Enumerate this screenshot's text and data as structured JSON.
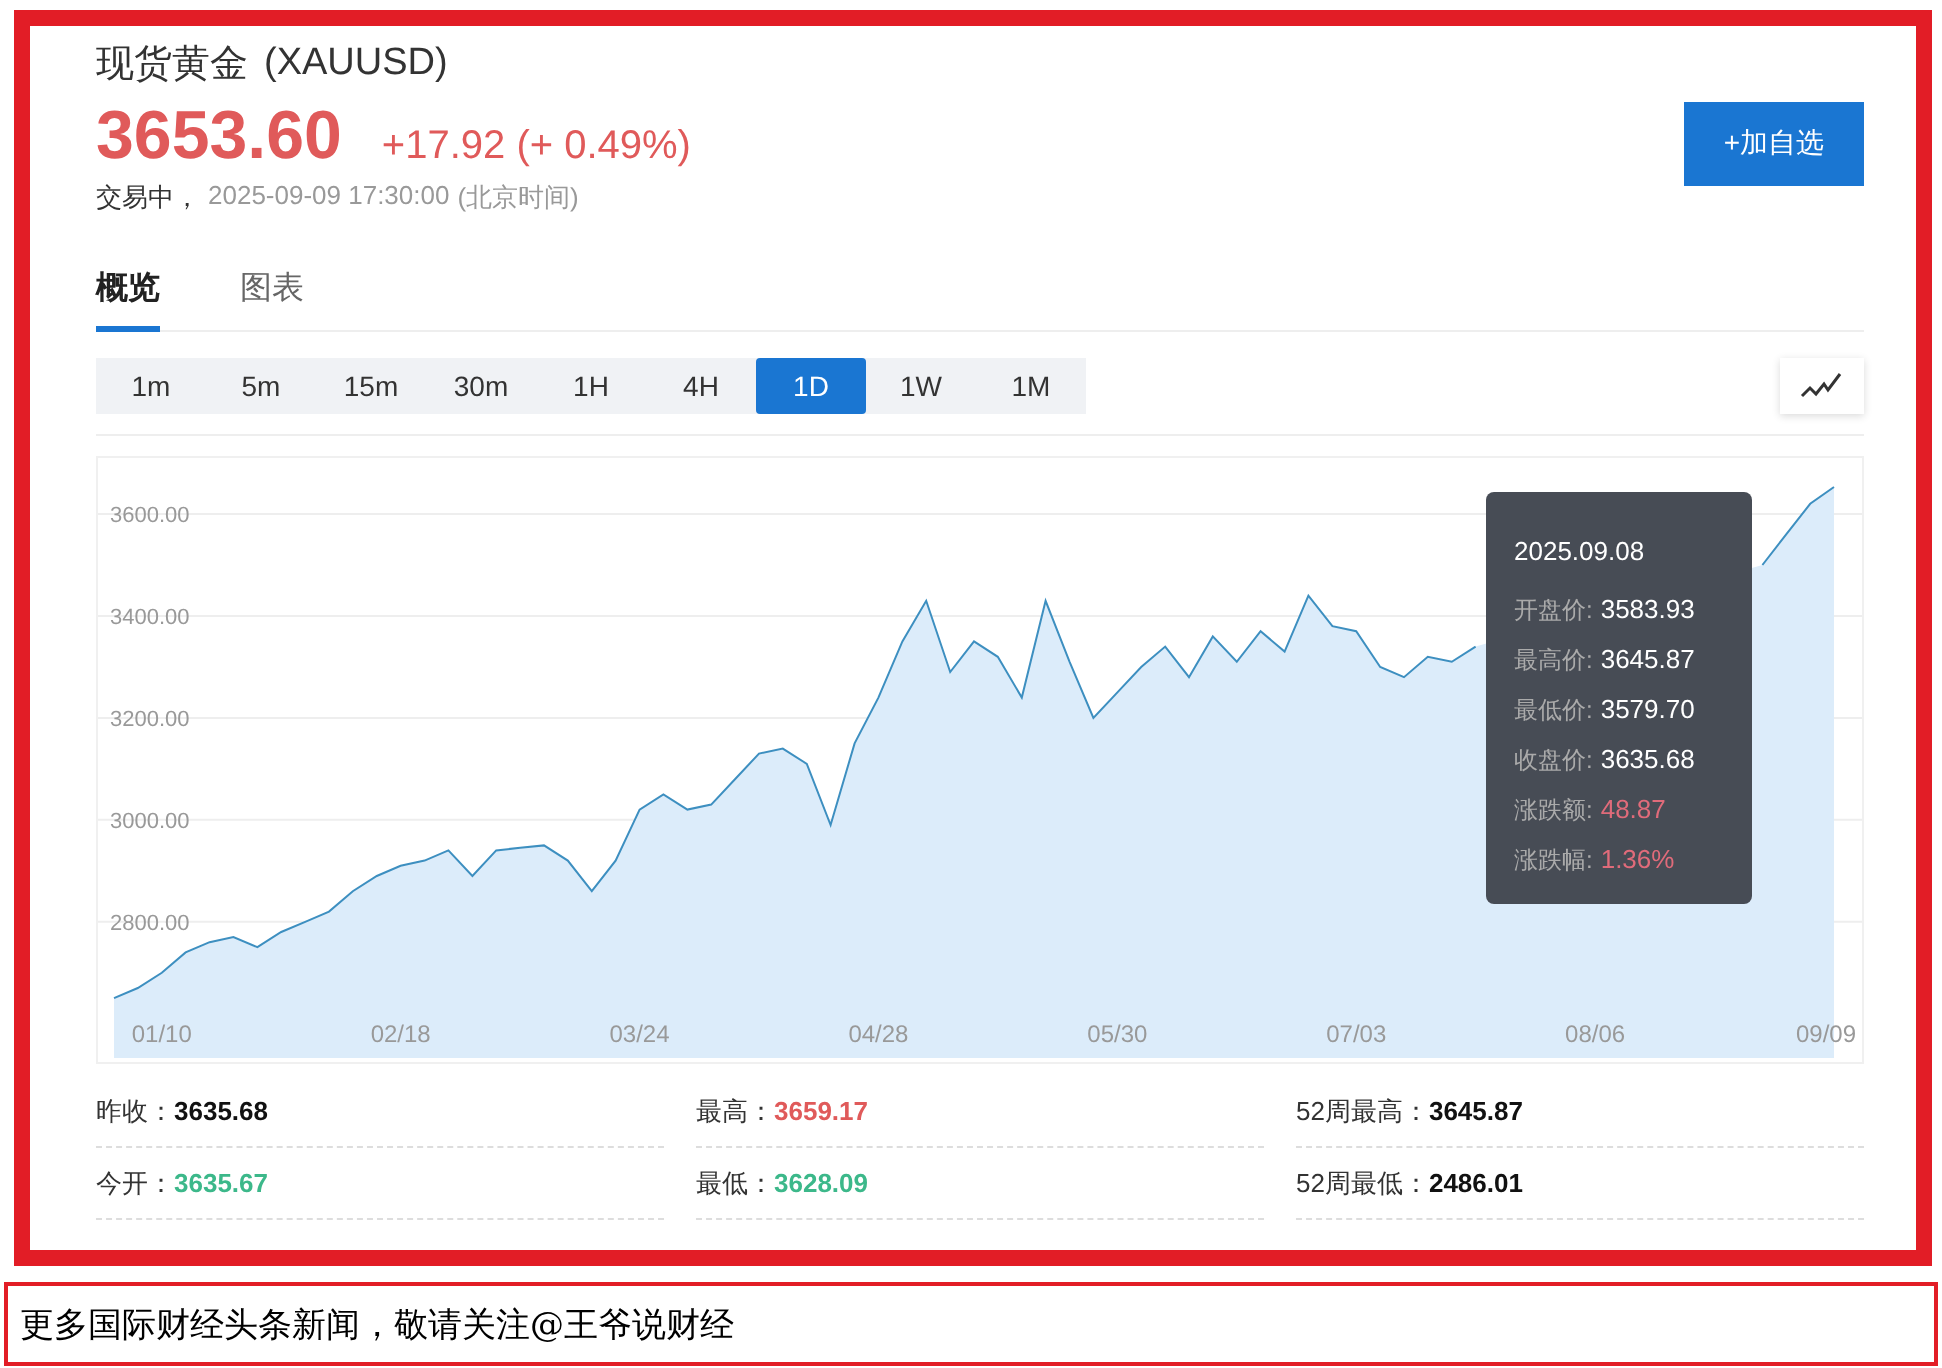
{
  "header": {
    "title": "现货黄金",
    "symbol": "(XAUUSD)",
    "price": "3653.60",
    "change": "+17.92",
    "change_pct": "(+ 0.49%)",
    "status": "交易中，",
    "time": "2025-09-09 17:30:00",
    "timezone": "(北京时间)",
    "watch_button": "+加自选"
  },
  "tabs": [
    {
      "label": "概览",
      "selected": true
    },
    {
      "label": "图表",
      "selected": false
    }
  ],
  "ranges": [
    {
      "label": "1m",
      "selected": false
    },
    {
      "label": "5m",
      "selected": false
    },
    {
      "label": "15m",
      "selected": false
    },
    {
      "label": "30m",
      "selected": false
    },
    {
      "label": "1H",
      "selected": false
    },
    {
      "label": "4H",
      "selected": false
    },
    {
      "label": "1D",
      "selected": true
    },
    {
      "label": "1W",
      "selected": false
    },
    {
      "label": "1M",
      "selected": false
    }
  ],
  "chart": {
    "chart_data": {
      "type": "area",
      "grid": true,
      "ylim": [
        2521,
        3710
      ],
      "categories": [
        null,
        null,
        "01/10",
        null,
        null,
        null,
        null,
        null,
        null,
        null,
        null,
        null,
        "02/18",
        null,
        null,
        null,
        null,
        null,
        null,
        null,
        null,
        null,
        "03/24",
        null,
        null,
        null,
        null,
        null,
        null,
        null,
        null,
        null,
        "04/28",
        null,
        null,
        null,
        null,
        null,
        null,
        null,
        null,
        null,
        "05/30",
        null,
        null,
        null,
        null,
        null,
        null,
        null,
        null,
        null,
        "07/03",
        null,
        null,
        null,
        null,
        null,
        null,
        null,
        null,
        null,
        "08/06",
        null,
        null,
        null,
        null,
        null,
        null,
        null,
        null,
        null,
        "09/09"
      ],
      "yticks": [
        {
          "value": 2800,
          "label": "2800.00"
        },
        {
          "value": 3000,
          "label": "3000.00"
        },
        {
          "value": 3200,
          "label": "3200.00"
        },
        {
          "value": 3400,
          "label": "3400.00"
        },
        {
          "value": 3600,
          "label": "3600.00"
        }
      ],
      "series": [
        {
          "color": "#3d8fc0",
          "values": [
            2650,
            2670,
            2700,
            2740,
            2760,
            2770,
            2750,
            2780,
            2800,
            2820,
            2860,
            2890,
            2910,
            2920,
            2940,
            2890,
            2940,
            2945,
            2950,
            2920,
            2860,
            2920,
            3020,
            3050,
            3020,
            3030,
            3080,
            3130,
            3140,
            3110,
            2990,
            3150,
            3240,
            3350,
            3430,
            3290,
            3350,
            3320,
            3240,
            3430,
            3310,
            3200,
            3250,
            3300,
            3340,
            3280,
            3360,
            3310,
            3370,
            3330,
            3440,
            3380,
            3370,
            3300,
            3280,
            3320,
            3310,
            3340,
            null,
            null,
            null,
            null,
            null,
            null,
            null,
            null,
            null,
            null,
            null,
            3500,
            3560,
            3620,
            3653
          ]
        }
      ]
    },
    "tooltip": {
      "date": "2025.09.08",
      "rows": [
        {
          "label": "开盘价:",
          "value": "3583.93",
          "color": "#ffffff"
        },
        {
          "label": "最高价:",
          "value": "3645.87",
          "color": "#ffffff"
        },
        {
          "label": "最低价:",
          "value": "3579.70",
          "color": "#ffffff"
        },
        {
          "label": "收盘价:",
          "value": "3635.68",
          "color": "#ffffff"
        },
        {
          "label": "涨跌额:",
          "value": "48.87",
          "color": "#e06b7a"
        },
        {
          "label": "涨跌幅:",
          "value": "1.36%",
          "color": "#e06b7a"
        }
      ]
    }
  },
  "stats": [
    [
      {
        "label": "昨收：",
        "value": "3635.68",
        "color": "#111111"
      },
      {
        "label": "今开：",
        "value": "3635.67",
        "color": "#3cb88a"
      }
    ],
    [
      {
        "label": "最高：",
        "value": "3659.17",
        "color": "#e05a5a"
      },
      {
        "label": "最低：",
        "value": "3628.09",
        "color": "#3cb88a"
      }
    ],
    [
      {
        "label": "52周最高：",
        "value": "3645.87",
        "color": "#111111"
      },
      {
        "label": "52周最低：",
        "value": "2486.01",
        "color": "#111111"
      }
    ]
  ],
  "caption": "更多国际财经头条新闻，敬请关注@王爷说财经"
}
